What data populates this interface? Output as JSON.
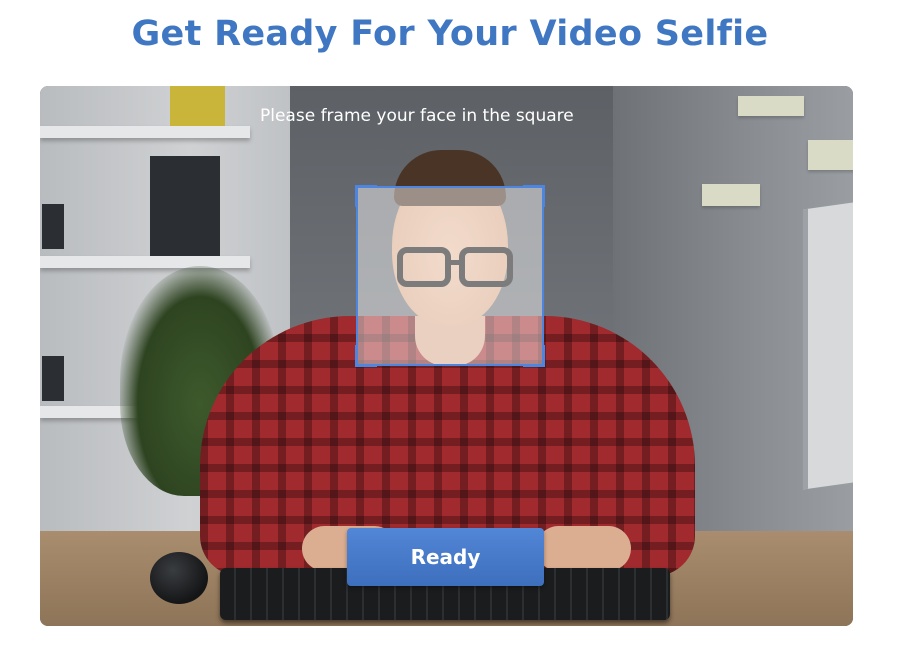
{
  "page": {
    "title": "Get Ready For Your Video Selfie"
  },
  "camera": {
    "instruction": "Please frame your face in the square",
    "frame_color": "#4d86e0",
    "ready_label": "Ready"
  },
  "colors": {
    "title": "#3f77c2",
    "button": "#4a7ccb"
  }
}
